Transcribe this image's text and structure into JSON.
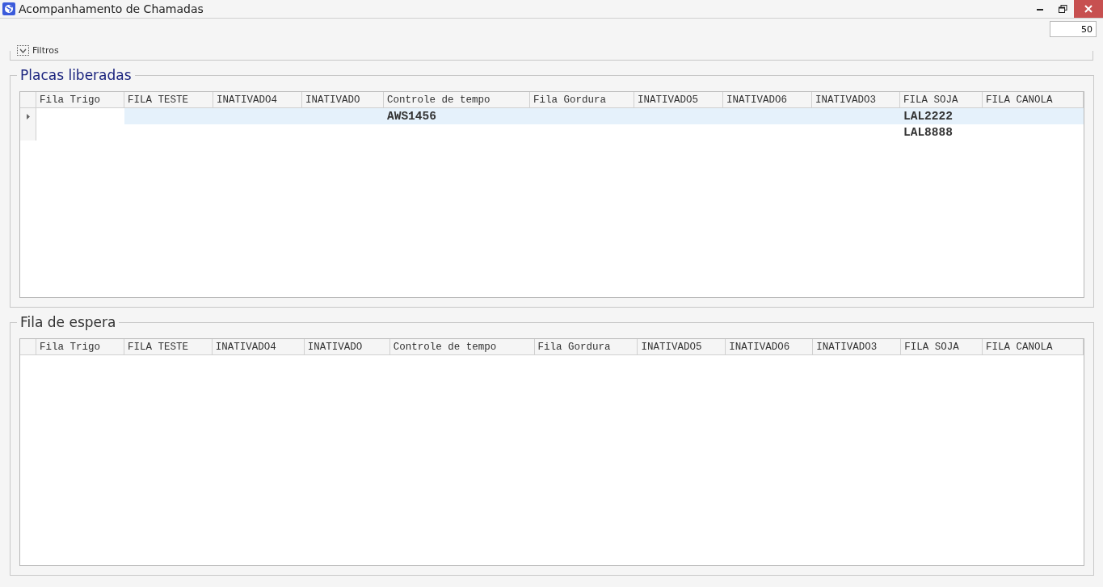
{
  "window": {
    "title": "Acompanhamento de Chamadas"
  },
  "count_field": {
    "value": "50"
  },
  "filters": {
    "label": "Filtros",
    "expanded": false
  },
  "panels": [
    {
      "title": "Placas liberadas",
      "columns": [
        "Fila Trigo",
        "FILA TESTE",
        "INATIVADO4",
        "INATIVADO",
        "Controle de tempo",
        "Fila Gordura",
        "INATIVADO5",
        "INATIVADO6",
        "INATIVADO3",
        "FILA SOJA",
        "FILA CANOLA"
      ],
      "rows": [
        {
          "selected": true,
          "cells": [
            "",
            "",
            "",
            "",
            "AWS1456",
            "",
            "",
            "",
            "",
            "LAL2222",
            ""
          ]
        },
        {
          "selected": false,
          "cells": [
            "",
            "",
            "",
            "",
            "",
            "",
            "",
            "",
            "",
            "LAL8888",
            ""
          ]
        }
      ]
    },
    {
      "title": "Fila de espera",
      "columns": [
        "Fila Trigo",
        "FILA TESTE",
        "INATIVADO4",
        "INATIVADO",
        "Controle de tempo",
        "Fila Gordura",
        "INATIVADO5",
        "INATIVADO6",
        "INATIVADO3",
        "FILA SOJA",
        "FILA CANOLA"
      ]
    }
  ]
}
